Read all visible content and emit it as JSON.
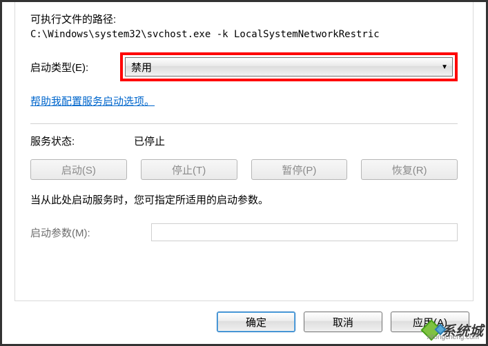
{
  "exePathLabel": "可执行文件的路径:",
  "exePathValue": "C:\\Windows\\system32\\svchost.exe -k LocalSystemNetworkRestric",
  "startupType": {
    "label": "启动类型",
    "accel": "(E)",
    "colon": ":",
    "selected": "禁用"
  },
  "helpLink": "帮助我配置服务启动选项。",
  "serviceStatus": {
    "label": "服务状态:",
    "value": "已停止"
  },
  "buttons": {
    "start": "启动(S)",
    "stop": "停止(T)",
    "pause": "暂停(P)",
    "resume": "恢复(R)"
  },
  "description": "当从此处启动服务时，您可指定所适用的启动参数。",
  "startParam": {
    "label": "启动参数",
    "accel": "(M)",
    "colon": ":",
    "value": ""
  },
  "footer": {
    "ok": "确定",
    "cancel": "取消",
    "apply": "应用(A)"
  },
  "watermark": {
    "text": "系统城",
    "url": "xitongcheng.com"
  }
}
